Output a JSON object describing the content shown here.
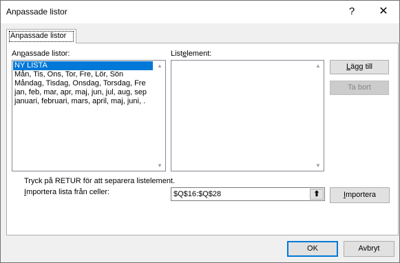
{
  "window": {
    "title": "Anpassade listor",
    "help_glyph": "?",
    "close_glyph": "✕"
  },
  "tab": {
    "label": "Anpassade listor"
  },
  "custom_lists": {
    "label_pre": "An",
    "label_ul": "p",
    "label_post": "assade listor:",
    "items": [
      "NY LISTA",
      "Mån, Tis, Ons, Tor, Fre, Lör, Sön",
      "Måndag, Tisdag, Onsdag, Torsdag, Fre",
      "jan, feb, mar, apr, maj, jun, jul, aug, sep",
      "januari, februari, mars, april, maj, juni, ."
    ],
    "selected_index": 0
  },
  "list_entries": {
    "label_pre": "List",
    "label_ul": "e",
    "label_post": "lement:",
    "value": ""
  },
  "buttons": {
    "add_ul": "L",
    "add_post": "ägg till",
    "delete_label": "Ta bort",
    "import_ul": "I",
    "import_post": "mportera",
    "ok_label": "OK",
    "cancel_label": "Avbryt"
  },
  "hint": "Tryck på RETUR för att separera listelement.",
  "import_from": {
    "label_ul": "I",
    "label_post": "mportera lista från celler:",
    "value": "$Q$16:$Q$28"
  },
  "icons": {
    "scroll_up": "▲",
    "scroll_down": "▼",
    "collapse": "⬆"
  }
}
